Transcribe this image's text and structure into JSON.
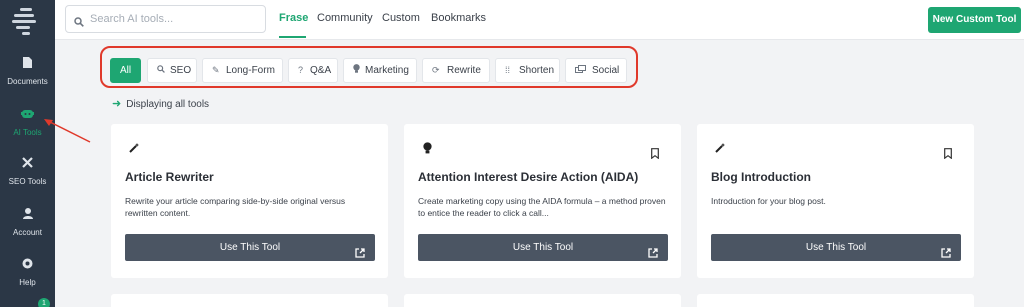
{
  "sidebar": {
    "items": [
      {
        "label": "Documents",
        "icon": "document-icon",
        "glyph": "▮"
      },
      {
        "label": "AI Tools",
        "icon": "robot-icon",
        "glyph": "⚉"
      },
      {
        "label": "SEO Tools",
        "icon": "tools-icon",
        "glyph": "✖"
      },
      {
        "label": "Account",
        "icon": "user-icon",
        "glyph": "●"
      },
      {
        "label": "Help",
        "icon": "help-icon",
        "glyph": "⊗"
      }
    ],
    "notification_count": "1"
  },
  "search": {
    "placeholder": "Search AI tools..."
  },
  "top_tabs": [
    "Frase",
    "Community",
    "Custom",
    "Bookmarks"
  ],
  "active_top_tab": "Frase",
  "new_custom_tool_label": "New Custom Tool",
  "filters": [
    {
      "label": "All",
      "icon": ""
    },
    {
      "label": "SEO",
      "icon": "search-icon"
    },
    {
      "label": "Long-Form",
      "icon": "pencil-icon"
    },
    {
      "label": "Q&A",
      "icon": "question-icon"
    },
    {
      "label": "Marketing",
      "icon": "lightbulb-icon"
    },
    {
      "label": "Rewrite",
      "icon": "refresh-icon"
    },
    {
      "label": "Shorten",
      "icon": "compress-icon"
    },
    {
      "label": "Social",
      "icon": "share-icon"
    }
  ],
  "active_filter": "All",
  "displaying_text": "Displaying all tools",
  "cards": [
    {
      "title": "Article Rewriter",
      "description": "Rewrite your article comparing side-by-side original versus rewritten content.",
      "icon": "magic-wand-icon",
      "bookmark": false,
      "button": "Use This Tool"
    },
    {
      "title": "Attention Interest Desire Action (AIDA)",
      "description": "Create marketing copy using the AIDA formula – a method proven to entice the reader to click a call...",
      "icon": "lightbulb-icon",
      "bookmark": true,
      "button": "Use This Tool"
    },
    {
      "title": "Blog Introduction",
      "description": "Introduction for your blog post.",
      "icon": "magic-wand-icon",
      "bookmark": true,
      "button": "Use This Tool"
    }
  ],
  "colors": {
    "accent": "#1ea672",
    "sidebar_bg": "#2b3746",
    "button_dark": "#4b5563",
    "annotation": "#e0392b"
  }
}
